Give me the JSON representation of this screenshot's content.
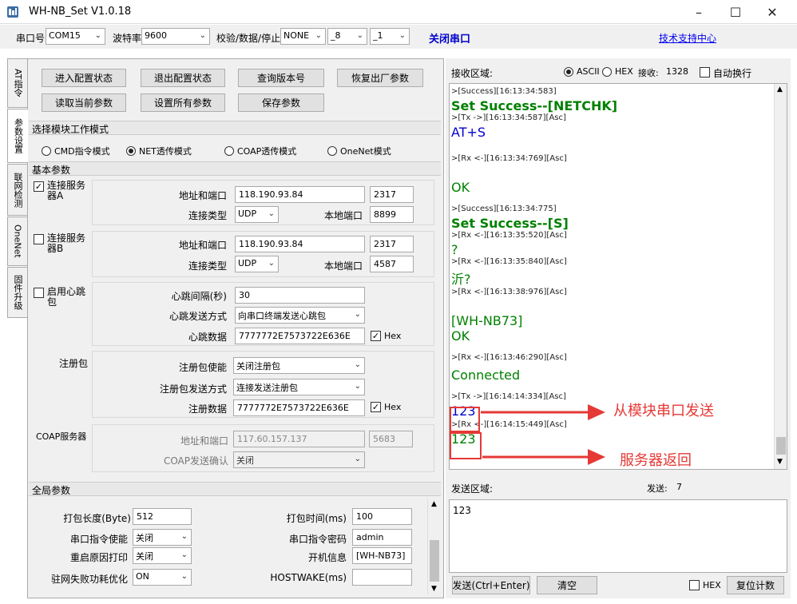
{
  "window": {
    "title": "WH-NB_Set V1.0.18"
  },
  "toolbar": {
    "port_label": "串口号",
    "port_value": "COM15",
    "baud_label": "波特率",
    "baud_value": "9600",
    "parity_label": "校验/数据/停止",
    "parity_value": "NONE",
    "data_value": "_8",
    "stop_value": "_1",
    "close_port": "关闭串口",
    "support": "技术支持中心"
  },
  "tabs": [
    "AT指令",
    "参数设置",
    "联网检测",
    "OneNet",
    "固件升级"
  ],
  "buttons": {
    "enter_config": "进入配置状态",
    "exit_config": "退出配置状态",
    "query_version": "查询版本号",
    "restore_factory": "恢复出厂参数",
    "read_params": "读取当前参数",
    "set_all": "设置所有参数",
    "save_params": "保存参数"
  },
  "mode": {
    "title": "选择模块工作模式",
    "options": [
      "CMD指令模式",
      "NET透传模式",
      "COAP透传模式",
      "OneNet模式"
    ],
    "selected_index": 1
  },
  "basic": {
    "title": "基本参数",
    "serverA": {
      "label": "连接服务器A",
      "checked": true,
      "addr_label": "地址和端口",
      "addr": "118.190.93.84",
      "port": "2317",
      "type_label": "连接类型",
      "type": "UDP",
      "local_label": "本地端口",
      "local": "8899"
    },
    "serverB": {
      "label": "连接服务器B",
      "checked": false,
      "addr_label": "地址和端口",
      "addr": "118.190.93.84",
      "port": "2317",
      "type_label": "连接类型",
      "type": "UDP",
      "local_label": "本地端口",
      "local": "4587"
    },
    "heartbeat": {
      "label": "启用心跳包",
      "interval_label": "心跳间隔(秒)",
      "interval": "30",
      "mode_label": "心跳发送方式",
      "mode": "向串口终端发送心跳包",
      "data_label": "心跳数据",
      "data": "7777772E7573722E636E",
      "hex_label": "Hex"
    },
    "register": {
      "label": "注册包",
      "enable_label": "注册包使能",
      "enable": "关闭注册包",
      "mode_label": "注册包发送方式",
      "mode": "连接发送注册包",
      "data_label": "注册数据",
      "data": "7777772E7573722E636E",
      "hex_label": "Hex"
    },
    "coap": {
      "label": "COAP服务器",
      "addr_label": "地址和端口",
      "addr": "117.60.157.137",
      "port": "5683",
      "confirm_label": "COAP发送确认",
      "confirm": "关闭"
    }
  },
  "global": {
    "title": "全局参数",
    "pack_len_label": "打包长度(Byte)",
    "pack_len": "512",
    "pack_time_label": "打包时间(ms)",
    "pack_time": "100",
    "uart_cmd_label": "串口指令使能",
    "uart_cmd": "关闭",
    "uart_pwd_label": "串口指令密码",
    "uart_pwd": "admin",
    "reboot_label": "重启原因打印",
    "reboot": "关闭",
    "boot_info_label": "开机信息",
    "boot_info": "[WH-NB73]",
    "lowpower_label": "驻网失败功耗优化",
    "lowpower": "ON",
    "hostwake_label": "HOSTWAKE(ms)",
    "hostwake": ""
  },
  "receive": {
    "label": "接收区域:",
    "ascii": "ASCII",
    "hex": "HEX",
    "count_label": "接收:",
    "count": "1328",
    "autowrap": "自动换行",
    "lines": [
      {
        "cls": "log-meta",
        "text": ">[Success][16:13:34:583]"
      },
      {
        "cls": "log-green-b",
        "text": "Set Success--[NETCHK]"
      },
      {
        "cls": "log-meta",
        "text": ">[Tx ->][16:13:34:587][Asc]"
      },
      {
        "cls": "log-blue",
        "text": "AT+S"
      },
      {
        "cls": "log-meta",
        "text": ">[Rx <-][16:13:34:769][Asc]"
      },
      {
        "cls": "log-green",
        "text": "OK"
      },
      {
        "cls": "log-meta",
        "text": ">[Success][16:13:34:775]"
      },
      {
        "cls": "log-green-b",
        "text": "Set Success--[S]"
      },
      {
        "cls": "log-meta",
        "text": ">[Rx <-][16:13:35:520][Asc]"
      },
      {
        "cls": "log-green",
        "text": "?"
      },
      {
        "cls": "log-meta",
        "text": ">[Rx <-][16:13:35:840][Asc]"
      },
      {
        "cls": "log-green",
        "text": "沂?"
      },
      {
        "cls": "log-meta",
        "text": ">[Rx <-][16:13:38:976][Asc]"
      },
      {
        "cls": "log-green",
        "text": "[WH-NB73]"
      },
      {
        "cls": "log-green",
        "text": "OK"
      },
      {
        "cls": "log-meta",
        "text": ">[Rx <-][16:13:46:290][Asc]"
      },
      {
        "cls": "log-green",
        "text": "Connected"
      },
      {
        "cls": "log-meta",
        "text": ">[Tx ->][16:14:14:334][Asc]"
      },
      {
        "cls": "log-blue",
        "text": "123"
      },
      {
        "cls": "log-meta",
        "text": ">[Rx <-][16:14:15:449][Asc]"
      },
      {
        "cls": "log-green",
        "text": "123"
      }
    ]
  },
  "annotations": {
    "send": "从模块串口发送",
    "recv": "服务器返回"
  },
  "send": {
    "label": "发送区域:",
    "count_label": "发送:",
    "count": "7",
    "content": "123",
    "send_btn": "发送(Ctrl+Enter)",
    "clear_btn": "清空",
    "hex": "HEX",
    "reset_btn": "复位计数"
  },
  "colors": {
    "accent_red": "#e53935",
    "log_green": "#008000",
    "log_blue": "#0000cc",
    "link_blue": "#0000ee"
  }
}
